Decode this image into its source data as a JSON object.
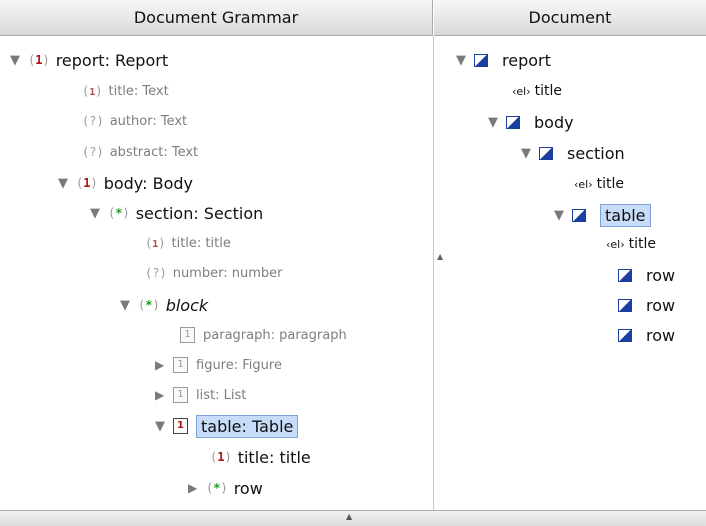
{
  "headers": {
    "left": "Document Grammar",
    "right": "Document"
  },
  "grammar": {
    "rows": [
      {
        "mult": "1",
        "label": "report: Report"
      },
      {
        "mult": "1",
        "label": "title: Text"
      },
      {
        "mult": "?",
        "label": "author: Text"
      },
      {
        "mult": "?",
        "label": "abstract: Text"
      },
      {
        "mult": "1",
        "label": "body: Body"
      },
      {
        "mult": "*",
        "label": "section: Section"
      },
      {
        "mult": "1",
        "label": "title: title"
      },
      {
        "mult": "?",
        "label": "number: number"
      },
      {
        "mult": "*",
        "label": "block"
      },
      {
        "mult": "1",
        "label": "paragraph: paragraph"
      },
      {
        "mult": "1",
        "label": "figure: Figure"
      },
      {
        "mult": "1",
        "label": "list: List"
      },
      {
        "mult": "1",
        "label": "table: Table"
      },
      {
        "mult": "1",
        "label": "title: title"
      },
      {
        "mult": "*",
        "label": "row"
      }
    ]
  },
  "document": {
    "attr_badge": "‹el›",
    "rows": [
      {
        "label": "report"
      },
      {
        "label": "title"
      },
      {
        "label": "body"
      },
      {
        "label": "section"
      },
      {
        "label": "title"
      },
      {
        "label": "table"
      },
      {
        "label": "title"
      },
      {
        "label": "row"
      },
      {
        "label": "row"
      },
      {
        "label": "row"
      }
    ]
  },
  "colors": {
    "mandatory": "#b11111",
    "repeat": "#1e9e1e",
    "optional": "#a0a0a0",
    "selection": "#c6dcf8",
    "element_icon": "#1a3fa0"
  }
}
